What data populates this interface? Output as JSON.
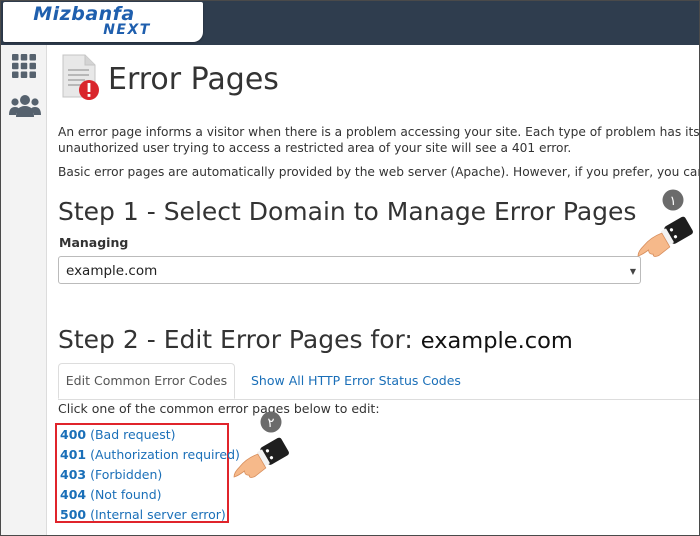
{
  "brand": {
    "logo_top": "Mizbanfa",
    "logo_bottom": "NEXT"
  },
  "sidebar": {
    "items": [
      {
        "icon": "grid-icon"
      },
      {
        "icon": "users-icon"
      }
    ]
  },
  "page": {
    "title": "Error Pages",
    "para1_line1": "An error page informs a visitor when there is a problem accessing your site. Each type of problem has its own",
    "para1_line2": "unauthorized user trying to access a restricted area of your site will see a 401 error.",
    "para2": "Basic error pages are automatically provided by the web server (Apache). However, if you prefer, you can create",
    "step1_title": "Step 1 - Select Domain to Manage Error Pages",
    "managing_label": "Managing",
    "domain_select_value": "example.com",
    "step2_prefix": "Step 2 - Edit Error Pages for:",
    "step2_domain": "example.com"
  },
  "tabs": [
    {
      "label": "Edit Common Error Codes",
      "active": true
    },
    {
      "label": "Show All HTTP Error Status Codes",
      "active": false
    }
  ],
  "instruction": "Click one of the common error pages below to edit:",
  "error_codes": [
    {
      "code": "400",
      "desc": "(Bad request)"
    },
    {
      "code": "401",
      "desc": "(Authorization required)"
    },
    {
      "code": "403",
      "desc": "(Forbidden)"
    },
    {
      "code": "404",
      "desc": "(Not found)"
    },
    {
      "code": "500",
      "desc": "(Internal server error)"
    }
  ],
  "annotations": [
    {
      "badge": "١"
    },
    {
      "badge": "٢"
    }
  ],
  "colors": {
    "topbar": "#2f3d4e",
    "link": "#1a6fb8",
    "highlight": "#e0242b",
    "logo": "#1f5fae"
  }
}
